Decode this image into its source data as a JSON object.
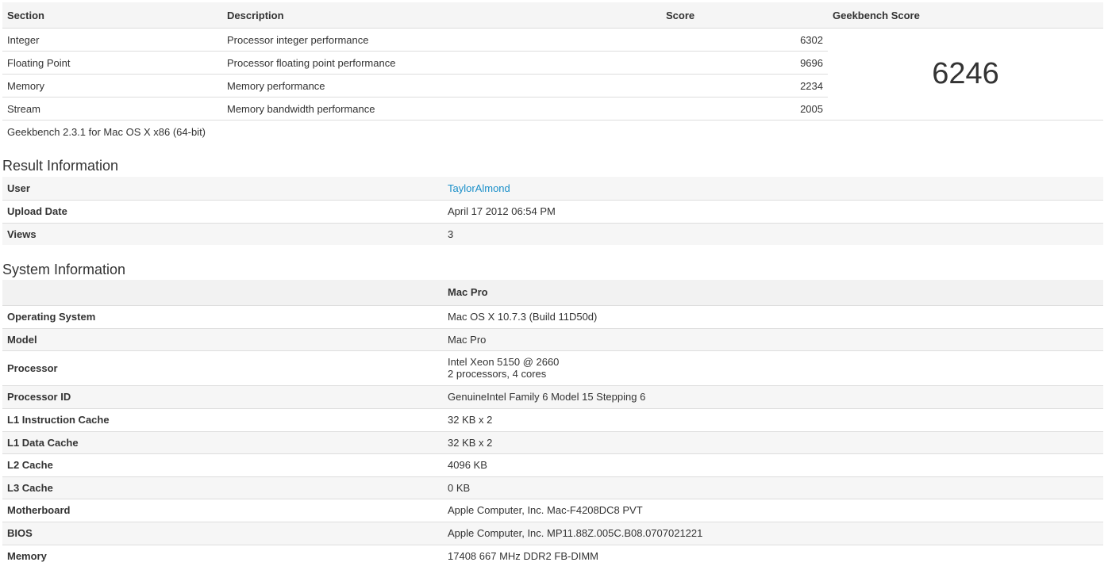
{
  "score_table": {
    "headers": {
      "section": "Section",
      "description": "Description",
      "score": "Score",
      "geekbench_score": "Geekbench Score"
    },
    "rows": [
      {
        "section": "Integer",
        "description": "Processor integer performance",
        "score": "6302"
      },
      {
        "section": "Floating Point",
        "description": "Processor floating point performance",
        "score": "9696"
      },
      {
        "section": "Memory",
        "description": "Memory performance",
        "score": "2234"
      },
      {
        "section": "Stream",
        "description": "Memory bandwidth performance",
        "score": "2005"
      }
    ],
    "total_score": "6246",
    "footer": "Geekbench 2.3.1 for Mac OS X x86 (64-bit)"
  },
  "result_information": {
    "title": "Result Information",
    "rows": [
      {
        "label": "User",
        "value": "TaylorAlmond"
      },
      {
        "label": "Upload Date",
        "value": "April 17 2012 06:54 PM"
      },
      {
        "label": "Views",
        "value": "3"
      }
    ]
  },
  "system_information": {
    "title": "System Information",
    "header_value": "Mac Pro",
    "rows": [
      {
        "label": "Operating System",
        "value": "Mac OS X 10.7.3 (Build 11D50d)"
      },
      {
        "label": "Model",
        "value": "Mac Pro"
      },
      {
        "label": "Processor",
        "value": "Intel Xeon 5150 @ 2660",
        "value2": "2 processors, 4 cores"
      },
      {
        "label": "Processor ID",
        "value": "GenuineIntel Family 6 Model 15 Stepping 6"
      },
      {
        "label": "L1 Instruction Cache",
        "value": "32 KB x 2"
      },
      {
        "label": "L1 Data Cache",
        "value": "32 KB x 2"
      },
      {
        "label": "L2 Cache",
        "value": "4096 KB"
      },
      {
        "label": "L3 Cache",
        "value": "0 KB"
      },
      {
        "label": "Motherboard",
        "value": "Apple Computer, Inc. Mac-F4208DC8 PVT"
      },
      {
        "label": "BIOS",
        "value": "Apple Computer, Inc. MP11.88Z.005C.B08.0707021221"
      },
      {
        "label": "Memory",
        "value": "17408 667 MHz DDR2 FB-DIMM"
      }
    ]
  },
  "colors": {
    "link": "#1a8fc9",
    "row_alt": "#f6f6f6",
    "border": "#dddddd"
  }
}
